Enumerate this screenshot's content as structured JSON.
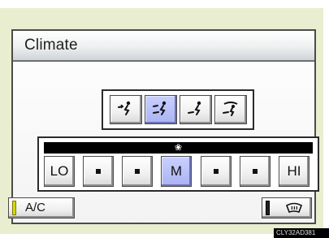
{
  "header": {
    "title": "Climate"
  },
  "airflow_modes": [
    {
      "icon": "face-airflow-icon",
      "selected": false
    },
    {
      "icon": "face-and-feet-airflow-icon",
      "selected": true
    },
    {
      "icon": "feet-airflow-icon",
      "selected": false
    },
    {
      "icon": "feet-and-windshield-airflow-icon",
      "selected": false
    }
  ],
  "fan": {
    "icon": "fan-icon",
    "levels": [
      {
        "label": "LO",
        "selected": false
      },
      {
        "label": "",
        "selected": false
      },
      {
        "label": "",
        "selected": false
      },
      {
        "label": "M",
        "selected": true
      },
      {
        "label": "",
        "selected": false
      },
      {
        "label": "",
        "selected": false
      },
      {
        "label": "HI",
        "selected": false
      }
    ]
  },
  "footer": {
    "ac_label": "A/C",
    "ac_indicator_color": "#d7d800",
    "defrost_icon": "windshield-defroster-icon",
    "image_code": "CLY32AD381"
  },
  "colors": {
    "bezel": "#e9eed1",
    "selected_button": "#aab3f3"
  }
}
